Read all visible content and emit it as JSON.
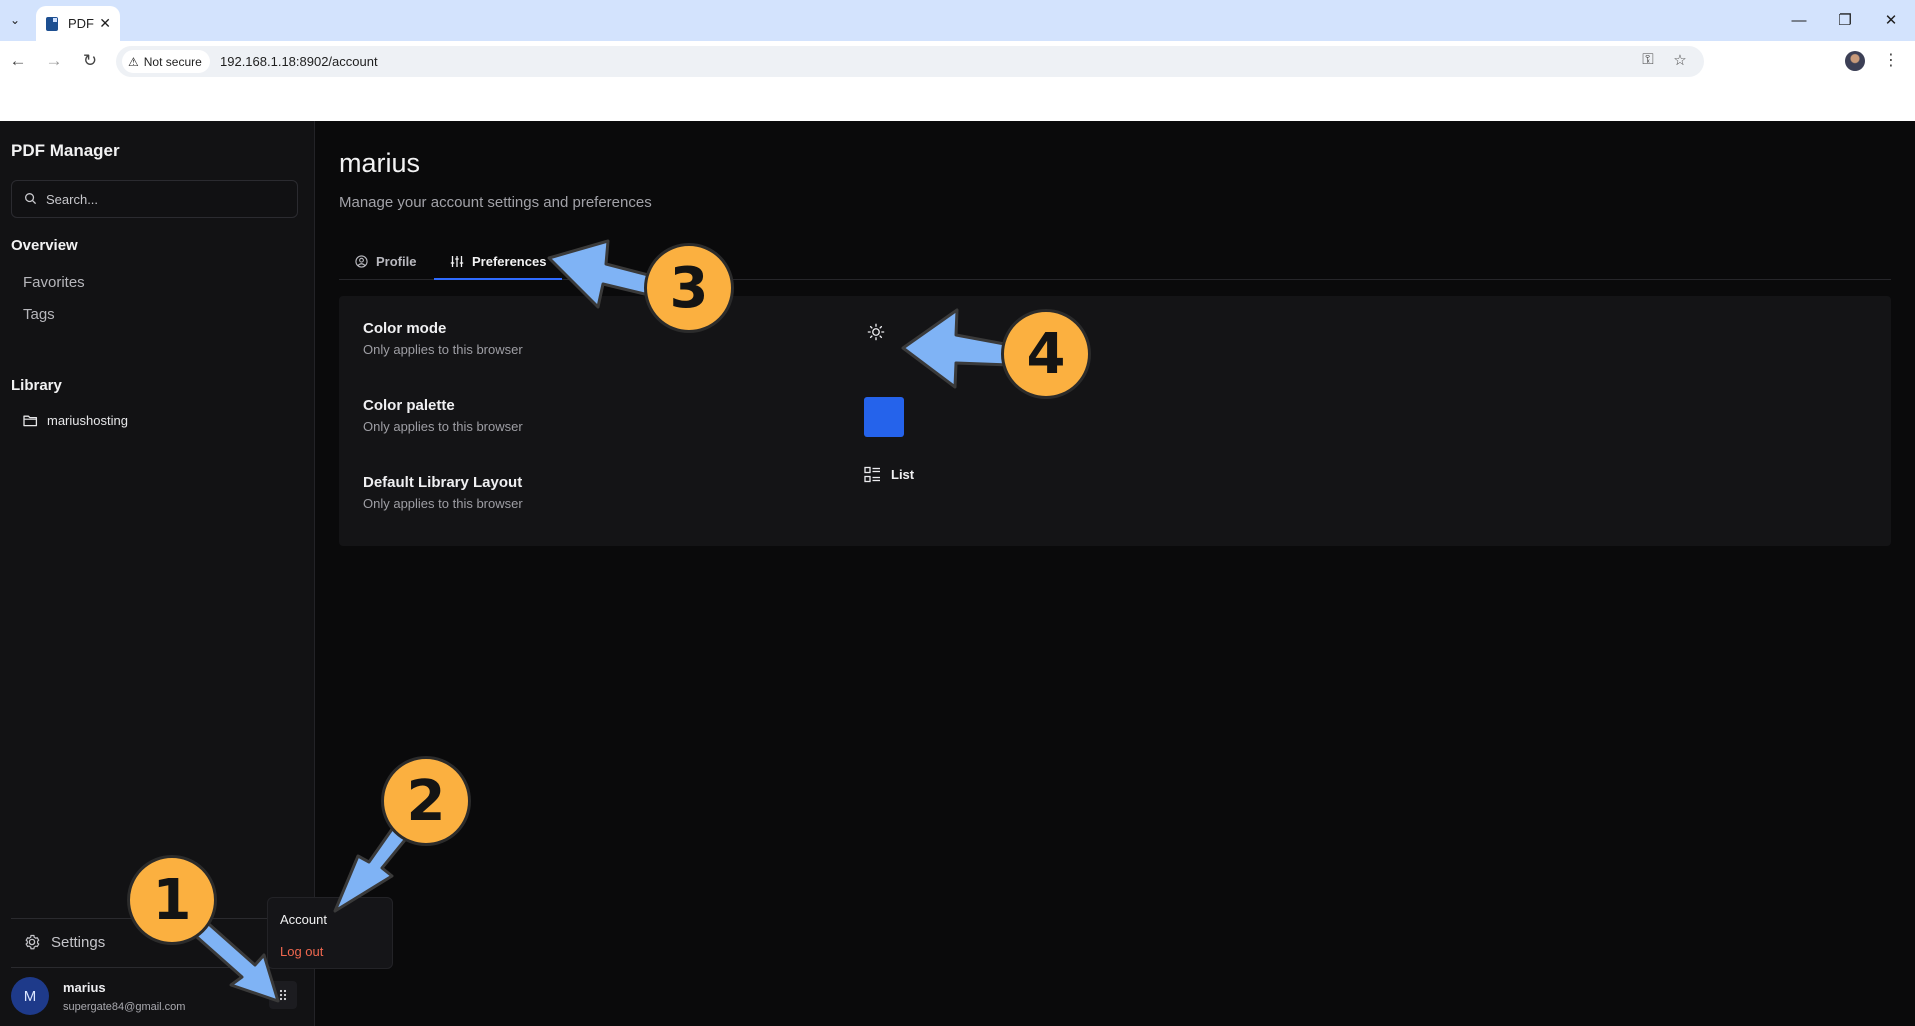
{
  "browser": {
    "tab_title": "PDF",
    "security_label": "Not secure",
    "url": "192.168.1.18:8902/account"
  },
  "sidebar": {
    "brand": "PDF Manager",
    "search_placeholder": "Search...",
    "overview_title": "Overview",
    "overview_items": [
      "Favorites",
      "Tags"
    ],
    "library_title": "Library",
    "library_items": [
      "mariushosting"
    ],
    "settings_label": "Settings",
    "user": {
      "initial": "M",
      "name": "marius",
      "email": "supergate84@gmail.com"
    }
  },
  "user_menu": {
    "account_label": "Account",
    "logout_label": "Log out",
    "logout_color": "#f0684f"
  },
  "main": {
    "title": "marius",
    "subtitle": "Manage your account settings and preferences",
    "tabs": [
      {
        "label": "Profile",
        "active": false
      },
      {
        "label": "Preferences",
        "active": true
      }
    ],
    "preferences": [
      {
        "label": "Color mode",
        "hint": "Only applies to this browser",
        "control": "sun-icon"
      },
      {
        "label": "Color palette",
        "hint": "Only applies to this browser",
        "control_color": "#2563eb"
      },
      {
        "label": "Default Library Layout",
        "hint": "Only applies to this browser",
        "control_label": "List"
      }
    ]
  },
  "annotations": {
    "badges": [
      "1",
      "2",
      "3",
      "4"
    ],
    "badge_color": "#fbb040",
    "arrow_color": "#7fb3f5"
  }
}
